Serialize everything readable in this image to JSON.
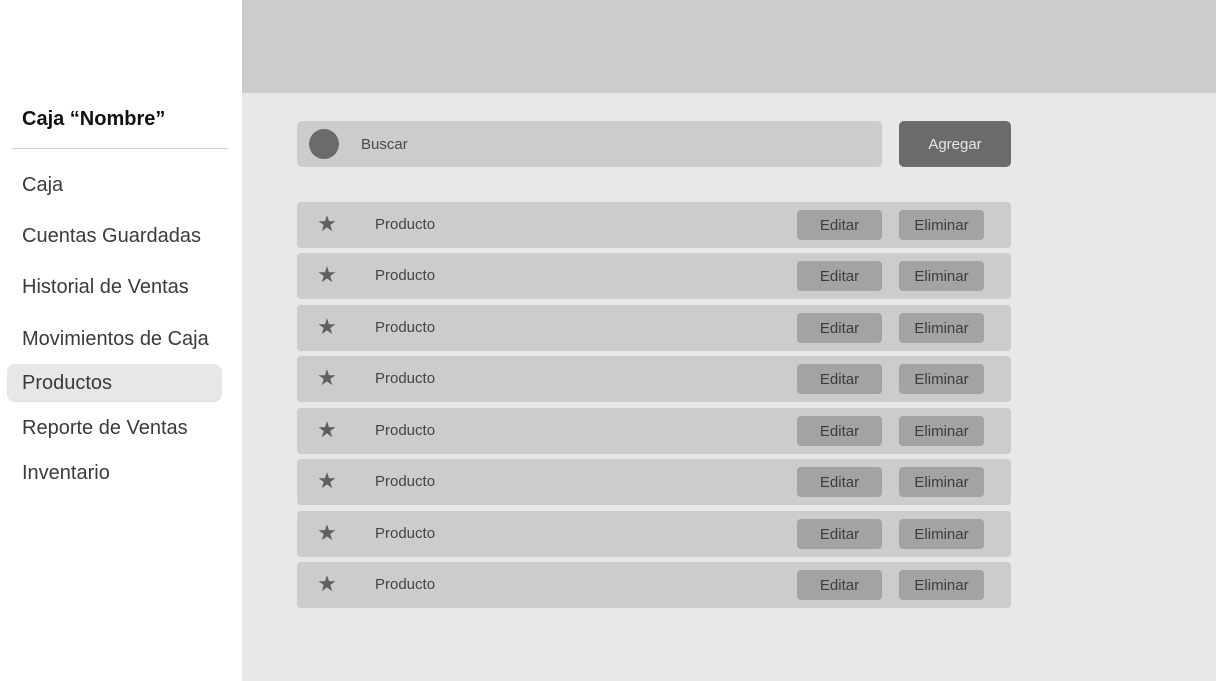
{
  "sidebar": {
    "title": "Caja “Nombre”",
    "items": [
      {
        "label": "Caja"
      },
      {
        "label": "Cuentas Guardadas"
      },
      {
        "label": "Historial de Ventas"
      },
      {
        "label": "Movimientos de Caja"
      },
      {
        "label": "Productos",
        "active": true
      },
      {
        "label": "Reporte de Ventas"
      },
      {
        "label": "Inventario"
      }
    ]
  },
  "search": {
    "placeholder": "Buscar",
    "icon": "search-icon"
  },
  "toolbar": {
    "add_label": "Agregar"
  },
  "products": [
    {
      "name": "Producto",
      "icon": "star-icon",
      "edit_label": "Editar",
      "delete_label": "Eliminar"
    },
    {
      "name": "Producto",
      "icon": "star-icon",
      "edit_label": "Editar",
      "delete_label": "Eliminar"
    },
    {
      "name": "Producto",
      "icon": "star-icon",
      "edit_label": "Editar",
      "delete_label": "Eliminar"
    },
    {
      "name": "Producto",
      "icon": "star-icon",
      "edit_label": "Editar",
      "delete_label": "Eliminar"
    },
    {
      "name": "Producto",
      "icon": "star-icon",
      "edit_label": "Editar",
      "delete_label": "Eliminar"
    },
    {
      "name": "Producto",
      "icon": "star-icon",
      "edit_label": "Editar",
      "delete_label": "Eliminar"
    },
    {
      "name": "Producto",
      "icon": "star-icon",
      "edit_label": "Editar",
      "delete_label": "Eliminar"
    },
    {
      "name": "Producto",
      "icon": "star-icon",
      "edit_label": "Editar",
      "delete_label": "Eliminar"
    }
  ],
  "colors": {
    "header": "#cccccc",
    "main_background": "#e8e8e8",
    "row_background": "#cccccc",
    "button_secondary": "#a3a3a3",
    "button_primary": "#6b6b6b",
    "active_nav": "#e7e7e7"
  }
}
